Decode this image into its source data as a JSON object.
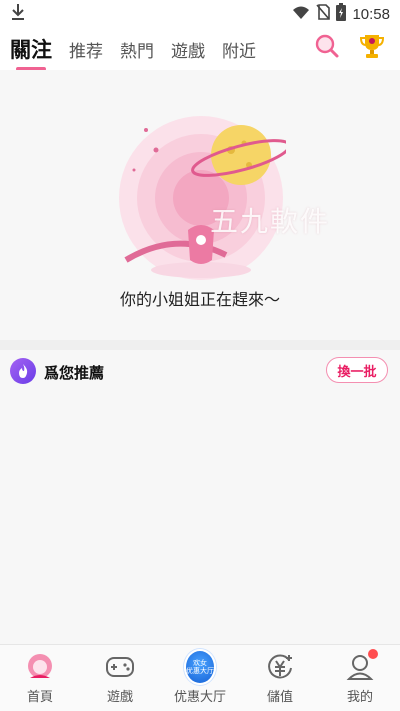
{
  "status_bar": {
    "time": "10:58"
  },
  "top_nav": {
    "tabs": [
      {
        "label": "關注",
        "active": true
      },
      {
        "label": "推荐",
        "active": false
      },
      {
        "label": "熱門",
        "active": false
      },
      {
        "label": "遊戲",
        "active": false
      },
      {
        "label": "附近",
        "active": false
      }
    ],
    "icons": [
      "search-icon",
      "trophy-icon"
    ]
  },
  "empty_state": {
    "message": "你的小姐姐正在趕來～",
    "watermark": "五九軟件"
  },
  "recommend": {
    "title": "爲您推薦",
    "refresh_label": "換一批"
  },
  "bottom_nav": {
    "items": [
      {
        "label": "首頁"
      },
      {
        "label": "遊戲"
      },
      {
        "label": "优惠大厅",
        "badge_line1": "欢女",
        "badge_line2": "优惠大厅"
      },
      {
        "label": "儲值"
      },
      {
        "label": "我的"
      }
    ]
  },
  "colors": {
    "accent": "#f06292",
    "refresh_border": "#f48fb1",
    "badge": "#ff4d4f",
    "rec_icon": "#8a4cf0"
  }
}
